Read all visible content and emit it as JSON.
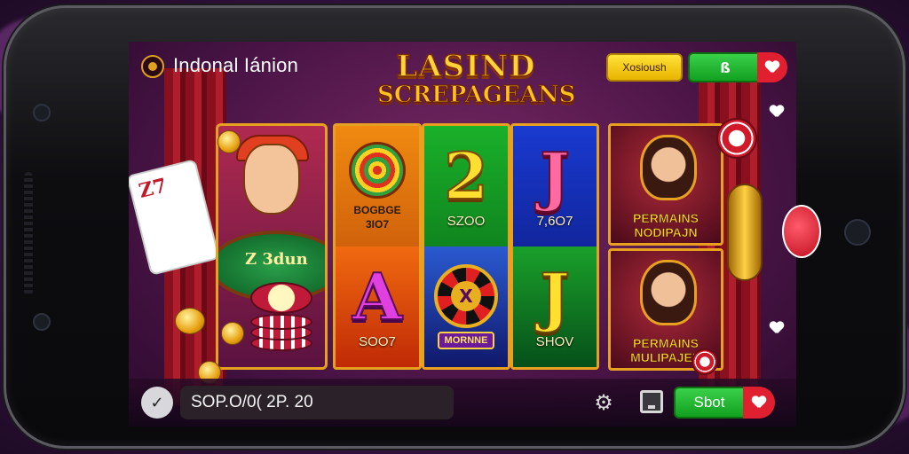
{
  "header": {
    "user_name": "Indonal Iánion",
    "logo_line1": "LASIND",
    "logo_line2": "SCREPAGEANS",
    "yellow_button": "Xosioush",
    "green_button": "ß"
  },
  "reels": {
    "reel1": {
      "top_label": "BOGBGE",
      "top_sub": "3IO7",
      "bottom_symbol": "A",
      "bottom_label": "SOO7"
    },
    "reel2": {
      "top_symbol": "2",
      "top_label": "SZOO",
      "bottom_symbol": "X",
      "bottom_badge": "MORNNE"
    },
    "reel3": {
      "top_symbol": "J",
      "top_label": "7,6O7",
      "bottom_symbol": "J",
      "bottom_label": "SHOV"
    }
  },
  "dealer_panel": {
    "table_text": "Z 3dun",
    "card_text": "Z7"
  },
  "promos": [
    {
      "line1": "PERMAINS",
      "line2": "NODIPAJN"
    },
    {
      "line1": "PERMAINS",
      "line2": "MULIPAJEN"
    }
  ],
  "bottom_bar": {
    "info_text": "SOP.O/0( 2P. 20",
    "start_label": "Sbot"
  },
  "colors": {
    "accent_gold": "#e8a020",
    "green_button": "#12a020",
    "red_button": "#e02030",
    "screen_bg": "#4a1446"
  },
  "icons": [
    "coin-icon",
    "heart-icon",
    "check-icon",
    "gear-icon",
    "box-icon"
  ]
}
